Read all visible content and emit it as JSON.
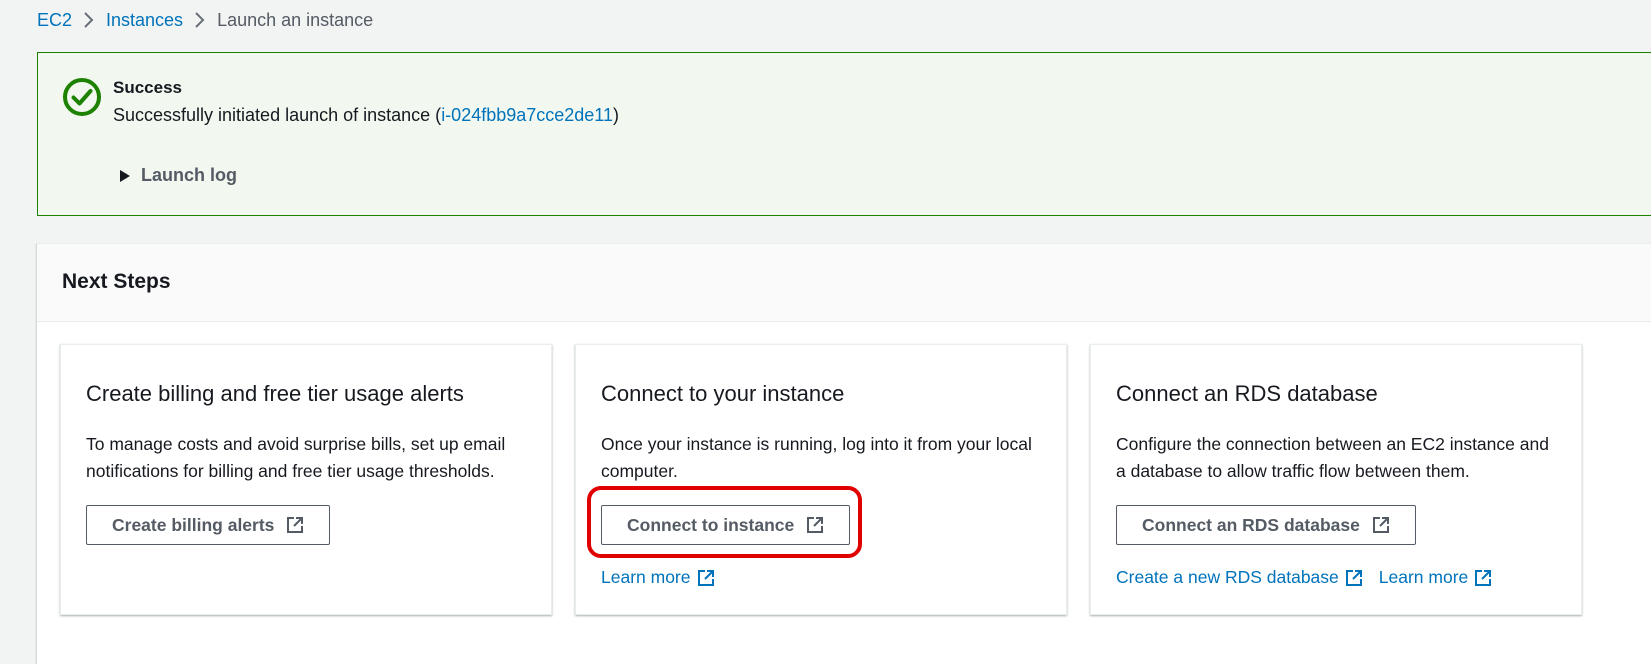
{
  "breadcrumb": {
    "items": [
      {
        "label": "EC2"
      },
      {
        "label": "Instances"
      },
      {
        "label": "Launch an instance"
      }
    ]
  },
  "alert": {
    "title": "Success",
    "message_prefix": "Successfully initiated launch of instance (",
    "instance_id": "i-024fbb9a7cce2de11",
    "message_suffix": ")",
    "launch_log_label": "Launch log",
    "color_success": "#1d8102"
  },
  "next_steps": {
    "title": "Next Steps",
    "cards": [
      {
        "title": "Create billing and free tier usage alerts",
        "description": "To manage costs and avoid surprise bills, set up email notifications for billing and free tier usage thresholds.",
        "button_label": "Create billing alerts"
      },
      {
        "title": "Connect to your instance",
        "description": "Once your instance is running, log into it from your local computer.",
        "button_label": "Connect to instance",
        "links": [
          "Learn more"
        ]
      },
      {
        "title": "Connect an RDS database",
        "description": "Configure the connection between an EC2 instance and a database to allow traffic flow between them.",
        "button_label": "Connect an RDS database",
        "links": [
          "Create a new RDS database",
          "Learn more"
        ]
      }
    ]
  },
  "colors": {
    "link": "#0073bb",
    "highlight": "#e00000",
    "background": "#f2f3f3"
  }
}
